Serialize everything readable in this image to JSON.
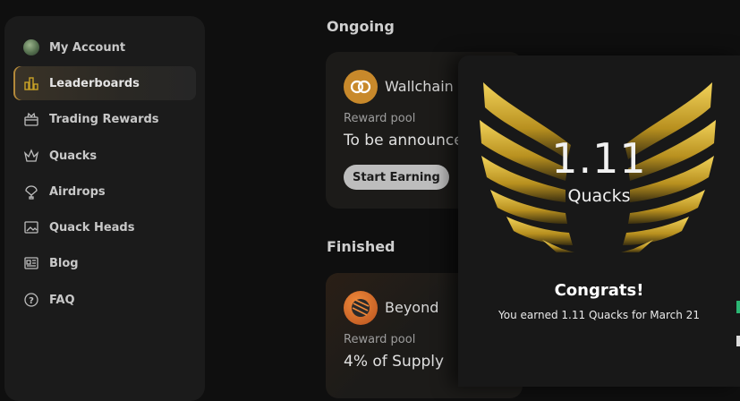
{
  "sidebar": {
    "items": [
      {
        "label": "My Account",
        "icon": "avatar"
      },
      {
        "label": "Leaderboards",
        "icon": "bar-chart-icon",
        "active": true
      },
      {
        "label": "Trading Rewards",
        "icon": "gift-icon"
      },
      {
        "label": "Quacks",
        "icon": "crown-icon"
      },
      {
        "label": "Airdrops",
        "icon": "balloon-icon"
      },
      {
        "label": "Quack Heads",
        "icon": "image-icon"
      },
      {
        "label": "Blog",
        "icon": "newspaper-icon"
      },
      {
        "label": "FAQ",
        "icon": "question-icon"
      }
    ]
  },
  "main": {
    "ongoing_title": "Ongoing",
    "finished_title": "Finished",
    "ongoing_card": {
      "name": "Wallchain",
      "pool_label": "Reward pool",
      "pool_value": "To be announced",
      "button": "Start Earning"
    },
    "finished_card": {
      "name": "Beyond",
      "pool_label": "Reward pool",
      "pool_value": "4% of Supply"
    }
  },
  "modal": {
    "amount": "1.11",
    "unit": "Quacks",
    "congrats": "Congrats!",
    "message": "You earned 1.11 Quacks for March 21"
  },
  "colors": {
    "accent_gold": "#c9a227",
    "wallchain_orange": "#c8892b",
    "beyond_orange": "#d06a2a"
  }
}
